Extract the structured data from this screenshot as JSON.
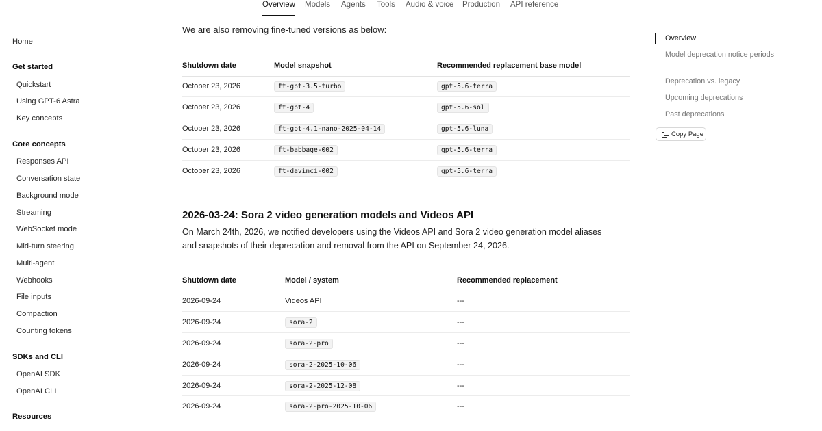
{
  "topnav": {
    "tabs": [
      {
        "label": "Overview",
        "active": true
      },
      {
        "label": "Models"
      },
      {
        "label": "Agents"
      },
      {
        "label": "Tools"
      },
      {
        "label": "Audio & voice"
      },
      {
        "label": "Production"
      },
      {
        "label": "API reference"
      }
    ]
  },
  "sidebar": {
    "home": "Home",
    "get_started": {
      "heading": "Get started",
      "items": [
        "Quickstart",
        "Using GPT-6 Astra",
        "Key concepts"
      ]
    },
    "core_concepts": {
      "heading": "Core concepts",
      "items": [
        "Responses API",
        "Conversation state",
        "Background mode",
        "Streaming",
        "WebSocket mode",
        "Mid-turn steering",
        "Multi-agent",
        "Webhooks",
        "File inputs",
        "Compaction",
        "Counting tokens"
      ]
    },
    "sdks": {
      "heading": "SDKs and CLI",
      "items": [
        "OpenAI SDK",
        "OpenAI CLI"
      ]
    },
    "resources": {
      "heading": "Resources"
    }
  },
  "main": {
    "intro": "We are also removing fine-tuned versions as below:",
    "table1": {
      "headers": [
        "Shutdown date",
        "Model snapshot",
        "Recommended replacement base model"
      ],
      "rows": [
        [
          "October 23, 2026",
          "ft-gpt-3.5-turbo",
          "gpt-5.6-terra"
        ],
        [
          "October 23, 2026",
          "ft-gpt-4",
          "gpt-5.6-sol"
        ],
        [
          "October 23, 2026",
          "ft-gpt-4.1-nano-2025-04-14",
          "gpt-5.6-luna"
        ],
        [
          "October 23, 2026",
          "ft-babbage-002",
          "gpt-5.6-terra"
        ],
        [
          "October 23, 2026",
          "ft-davinci-002",
          "gpt-5.6-terra"
        ]
      ]
    },
    "section2_title": "2026-03-24: Sora 2 video generation models and Videos API",
    "section2_para": "On March 24th, 2026, we notified developers using the Videos API and Sora 2 video generation model aliases and snapshots of their deprecation and removal from the API on September 24, 2026.",
    "table2": {
      "headers": [
        "Shutdown date",
        "Model / system",
        "Recommended replacement"
      ],
      "rows": [
        {
          "date": "2026-09-24",
          "model": "Videos API",
          "code": false,
          "replacement": "---"
        },
        {
          "date": "2026-09-24",
          "model": "sora-2",
          "code": true,
          "replacement": "---"
        },
        {
          "date": "2026-09-24",
          "model": "sora-2-pro",
          "code": true,
          "replacement": "---"
        },
        {
          "date": "2026-09-24",
          "model": "sora-2-2025-10-06",
          "code": true,
          "replacement": "---"
        },
        {
          "date": "2026-09-24",
          "model": "sora-2-2025-12-08",
          "code": true,
          "replacement": "---"
        },
        {
          "date": "2026-09-24",
          "model": "sora-2-pro-2025-10-06",
          "code": true,
          "replacement": "---"
        }
      ]
    }
  },
  "toc": {
    "items": [
      {
        "label": "Overview",
        "active": true
      },
      {
        "label": "Model deprecation notice periods"
      },
      {
        "label": "Deprecation vs. legacy"
      },
      {
        "label": "Upcoming deprecations"
      },
      {
        "label": "Past deprecations"
      }
    ],
    "copy_label": "Copy Page"
  }
}
